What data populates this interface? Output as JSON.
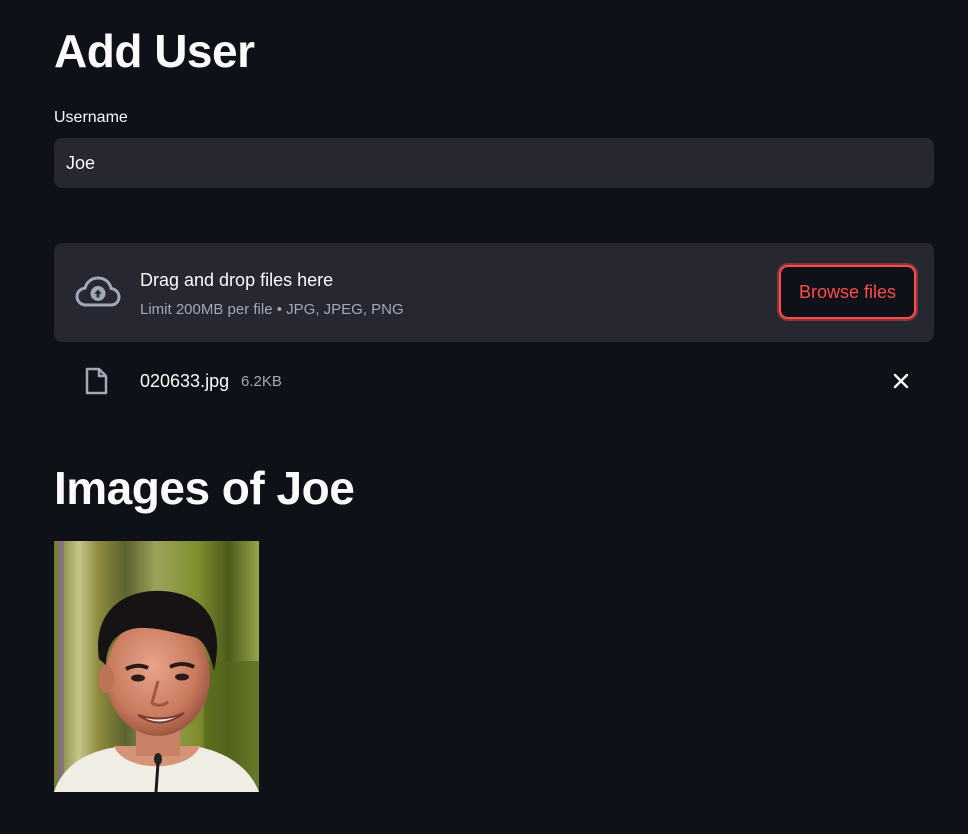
{
  "page": {
    "title": "Add User"
  },
  "username_field": {
    "label": "Username",
    "value": "Joe"
  },
  "file_uploader": {
    "drop_text": "Drag and drop files here",
    "limit_text": "Limit 200MB per file • JPG, JPEG, PNG",
    "browse_label": "Browse files",
    "upload_icon": "cloud-upload-icon"
  },
  "uploaded_file": {
    "name": "020633.jpg",
    "size": "6.2KB",
    "file_icon": "file-icon",
    "remove_icon": "close-icon"
  },
  "images_section": {
    "heading": "Images of Joe"
  },
  "colors": {
    "background": "#0e1117",
    "input_background": "#262730",
    "accent": "#ff4b4b",
    "text": "#fafafa",
    "muted_text": "#a3a8b8"
  }
}
